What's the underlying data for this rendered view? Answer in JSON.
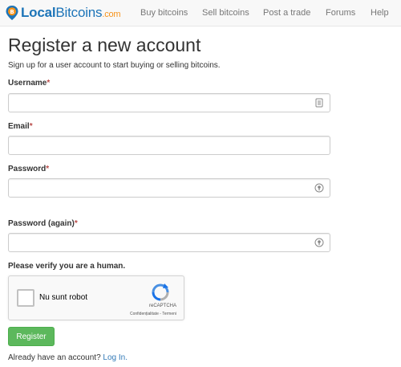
{
  "brand": {
    "name_bold": "Local",
    "name_rest": "Bitcoins",
    "domain": ".com",
    "primary_color": "#1c74b8",
    "accent_color": "#f7931a"
  },
  "nav": {
    "items": [
      {
        "label": "Buy bitcoins"
      },
      {
        "label": "Sell bitcoins"
      },
      {
        "label": "Post a trade"
      },
      {
        "label": "Forums"
      },
      {
        "label": "Help"
      }
    ]
  },
  "page": {
    "title": "Register a new account",
    "subtitle": "Sign up for a user account to start buying or selling bitcoins."
  },
  "form": {
    "required_marker": "*",
    "username": {
      "label": "Username",
      "value": "",
      "icon": "contact-card-icon"
    },
    "email": {
      "label": "Email",
      "value": ""
    },
    "password": {
      "label": "Password",
      "value": "",
      "icon": "password-manager-icon"
    },
    "password_again": {
      "label": "Password (again)",
      "value": "",
      "icon": "password-manager-icon"
    },
    "verify_label": "Please verify you are a human.",
    "captcha": {
      "checkbox_label": "Nu sunt robot",
      "brand": "reCAPTCHA",
      "links": "Confidențialitate - Termeni",
      "checked": false
    },
    "submit_label": "Register",
    "submit_color": "#5cb85c"
  },
  "footer": {
    "text": "Already have an account? ",
    "link": "Log In."
  }
}
